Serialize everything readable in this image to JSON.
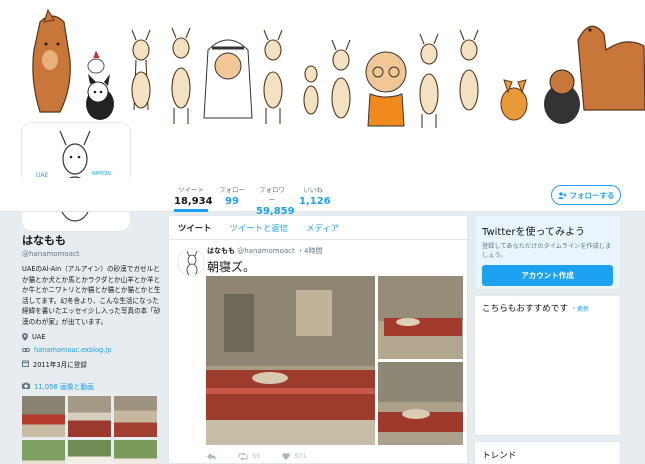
{
  "profile": {
    "name": "はなもも",
    "handle": "@hanamomoact",
    "bio": "UAEのAl-Ain（アルアイン）の砂漠でガゼルとか猫とか犬とか馬とかラクダとか山羊とか羊とか牛とかニワトリとか猫とか猫とか猫とかと生活してます。幻冬舎より、こんな生活になった経緯を書いたエッセイ少し入った写真の本「砂漠のわが家」が出ています。",
    "location": "UAE",
    "website": "hanamomoac.exblog.jp",
    "joined": "2011年3月に登録",
    "photos_label": "11,058 画像と動画",
    "avatar_text_uae": "UAE",
    "avatar_text_nippon": "NIPPON"
  },
  "stats": [
    {
      "label": "ツイート",
      "value": "18,934"
    },
    {
      "label": "フォロー",
      "value": "99"
    },
    {
      "label": "フォロワー",
      "value": "59,859"
    },
    {
      "label": "いいね",
      "value": "1,126"
    }
  ],
  "follow_button": "フォローする",
  "tabs": [
    "ツイート",
    "ツイートと返信",
    "メディア"
  ],
  "tweet": {
    "author": "はなもも",
    "handle": "@hanamomoact",
    "time": "・4時間",
    "text": "朝寝ズ。",
    "retweets": "55",
    "likes": "571"
  },
  "sidebar": {
    "try_title": "Twitterを使ってみよう",
    "try_sub": "登録してあなただけのタイムラインを作成しましょう。",
    "try_button": "アカウント作成",
    "rec_title": "こちらもおすすめです",
    "rec_update": "・更新",
    "trend_title": "トレンド"
  },
  "colors": {
    "accent": "#1da1f2",
    "text": "#14171a",
    "muted": "#657786",
    "background": "#e6ecf0"
  }
}
